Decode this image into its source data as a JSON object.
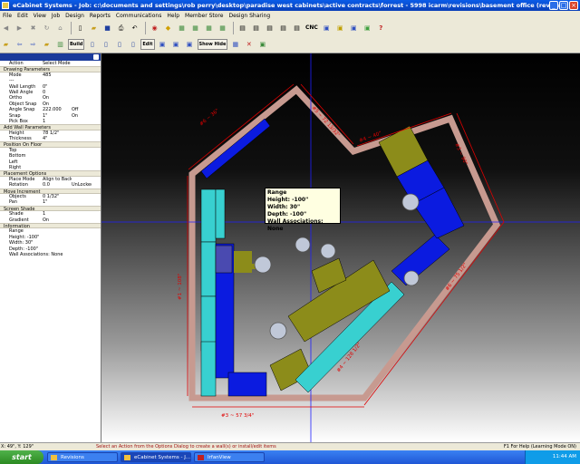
{
  "window": {
    "title": "eCabinet Systems - Job: c:\\documents and settings\\rob perry\\desktop\\paradise west cabinets\\active contracts\\forrest - 5998 icarm\\revisions\\basement office (revised)"
  },
  "menu": [
    "File",
    "Edit",
    "View",
    "Job",
    "Design",
    "Reports",
    "Communications",
    "Help",
    "Member Store",
    "Design Sharing"
  ],
  "toolbar": {
    "cnc_label": "CNC",
    "build_label": "Build",
    "edit_label": "Edit",
    "show_label": "Show",
    "hide_label": "Hide"
  },
  "panel": {
    "rows1": [
      {
        "k": "Action",
        "v": "Select Mode"
      },
      {
        "k": "Drawing Parameters",
        "section": true
      },
      {
        "k": "Mode",
        "v": "485"
      },
      {
        "k": "---",
        "v": ""
      },
      {
        "k": "Wall Length",
        "v": "0\""
      },
      {
        "k": "Wall Angle",
        "v": "0"
      },
      {
        "k": "Ortho",
        "v": "On"
      },
      {
        "k": "Object Snap",
        "v": "On"
      },
      {
        "k": "Angle Snap",
        "v": "222.000",
        "v2": "Off"
      },
      {
        "k": "Snap",
        "v": "1\"",
        "v2": "On"
      },
      {
        "k": "Pick Box",
        "v": "1"
      },
      {
        "k": "Add Wall Parameters",
        "section": true
      },
      {
        "k": "Height",
        "v": "78 1/2\""
      },
      {
        "k": "Thickness",
        "v": "4\""
      },
      {
        "k": "Position On Floor",
        "section": true
      },
      {
        "k": "Top",
        "v": ""
      },
      {
        "k": "Bottom",
        "v": ""
      },
      {
        "k": "Left",
        "v": ""
      },
      {
        "k": "Right",
        "v": ""
      },
      {
        "k": "Placement Options",
        "section": true
      },
      {
        "k": "Place Mode",
        "v": "Align to Back"
      },
      {
        "k": "Rotation",
        "v": "0.0",
        "v2": "UnLocked"
      },
      {
        "k": "Move Increment",
        "section": true
      },
      {
        "k": "Objects",
        "v": "0 1/32\""
      },
      {
        "k": "Pan",
        "v": "1\""
      },
      {
        "k": "Screen Shade",
        "section": true
      },
      {
        "k": "Shade",
        "v": "1"
      },
      {
        "k": "Gradient",
        "v": "On"
      },
      {
        "k": "Information",
        "section": true
      }
    ],
    "info": [
      "Range",
      "Height: -100\"",
      "Width: 30\"",
      "Depth: -100\"",
      "Wall Associations: None"
    ]
  },
  "tooltip": {
    "lines": [
      "Range",
      "Height: -100\"",
      "Width: 30\"",
      "Depth: -100\"",
      "Wall Associations: None"
    ]
  },
  "dimensions": {
    "top_left": "#6 ~ 36\"",
    "top_right_a": "#5 ~ 72 13/32\"",
    "top_right_b": "#4 ~ 40\"",
    "right_upper": "#3 ~ 90\"",
    "right_lower": "#6 ~ 75 1/2\"",
    "bottom_diag": "#4 ~ 128 1/2\"",
    "left": "#1 ~ 108\"",
    "bottom": "#3 ~ 57 3/4\""
  },
  "status": {
    "coords": "X: 49\", Y: 129\"",
    "hint": "Select an Action from the Options Dialog to create a wall(s) or install/edit items",
    "help": "F1 For Help (Learning Mode ON)"
  },
  "taskbar": {
    "start": "start",
    "tasks": [
      "Revisions",
      "eCabinet Systems - J...",
      "IrfanView"
    ],
    "clock": "11:44 AM"
  },
  "colors": {
    "wall": "#c79a90",
    "cabinet_blue": "#0b1be0",
    "cabinet_cyan": "#38d0d0",
    "appliance_olive": "#8c8c1a",
    "dim_red": "#e00000",
    "guide_blue": "#2020ff"
  }
}
